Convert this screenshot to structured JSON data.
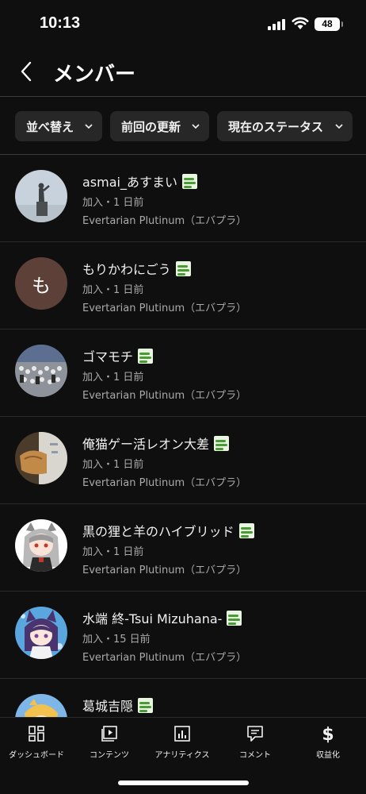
{
  "status_bar": {
    "time": "10:13",
    "battery": "48"
  },
  "header": {
    "title": "メンバー"
  },
  "filters": [
    {
      "label": "並べ替え"
    },
    {
      "label": "前回の更新"
    },
    {
      "label": "現在のステータス"
    }
  ],
  "members": [
    {
      "name": "asmai_あすまい",
      "joined": "加入・1 日前",
      "tier": "Evertarian Plutinum（エバプラ）",
      "avatar": "statue-photo"
    },
    {
      "name": "もりかわにごう",
      "joined": "加入・1 日前",
      "tier": "Evertarian Plutinum（エバプラ）",
      "avatar": "letter",
      "avatar_letter": "も"
    },
    {
      "name": "ゴマモチ",
      "joined": "加入・1 日前",
      "tier": "Evertarian Plutinum（エバプラ）",
      "avatar": "crowd-photo"
    },
    {
      "name": "俺猫ゲー活レオン大差",
      "joined": "加入・1 日前",
      "tier": "Evertarian Plutinum（エバプラ）",
      "avatar": "bread-photo"
    },
    {
      "name": "黒の狸と羊のハイブリッド",
      "joined": "加入・1 日前",
      "tier": "Evertarian Plutinum（エバプラ）",
      "avatar": "anime-wolf-girl"
    },
    {
      "name": "水端 終-Tsui Mizuhana-",
      "joined": "加入・15 日前",
      "tier": "Evertarian Plutinum（エバプラ）",
      "avatar": "anime-cat-girl"
    },
    {
      "name": "葛城吉隠",
      "joined": "",
      "tier": "",
      "avatar": "anime-blond"
    }
  ],
  "bottom_nav": [
    {
      "label": "ダッシュボード",
      "icon": "dashboard-icon"
    },
    {
      "label": "コンテンツ",
      "icon": "content-icon"
    },
    {
      "label": "アナリティクス",
      "icon": "analytics-icon"
    },
    {
      "label": "コメント",
      "icon": "comment-icon"
    },
    {
      "label": "収益化",
      "icon": "dollar-icon"
    }
  ],
  "colors": {
    "background": "#0f0f0f",
    "chip": "#272727",
    "secondary_text": "#aaaaaa",
    "letter_avatar": "#5d4037"
  }
}
